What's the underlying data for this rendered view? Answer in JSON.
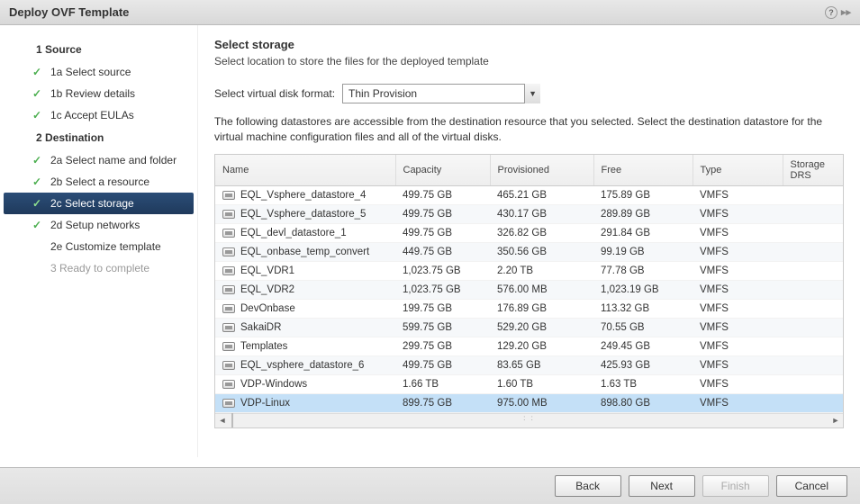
{
  "title": "Deploy OVF Template",
  "sidebar": {
    "sections": [
      {
        "num": "1",
        "label": "Source"
      },
      {
        "num": "2",
        "label": "Destination"
      }
    ],
    "items": [
      {
        "label": "1a Select source",
        "done": true
      },
      {
        "label": "1b Review details",
        "done": true
      },
      {
        "label": "1c Accept EULAs",
        "done": true
      },
      {
        "label": "2a Select name and folder",
        "done": true
      },
      {
        "label": "2b Select a resource",
        "done": true
      },
      {
        "label": "2c Select storage",
        "done": true,
        "current": true
      },
      {
        "label": "2d Setup networks",
        "done": true
      },
      {
        "label": "2e Customize template",
        "done": false
      },
      {
        "label": "3 Ready to complete",
        "done": false,
        "pending": true
      }
    ]
  },
  "main": {
    "heading": "Select storage",
    "subtitle": "Select location to store the files for the deployed template",
    "disk_format_label": "Select virtual disk format:",
    "disk_format_value": "Thin Provision",
    "description": "The following datastores are accessible from the destination resource that you selected. Select the destination datastore for the virtual machine configuration files and all of the virtual disks.",
    "columns": {
      "name": "Name",
      "capacity": "Capacity",
      "provisioned": "Provisioned",
      "free": "Free",
      "type": "Type",
      "storage_drs": "Storage DRS"
    },
    "rows": [
      {
        "name": "EQL_Vsphere_datastore_4",
        "capacity": "499.75 GB",
        "provisioned": "465.21 GB",
        "free": "175.89 GB",
        "type": "VMFS"
      },
      {
        "name": "EQL_Vsphere_datastore_5",
        "capacity": "499.75 GB",
        "provisioned": "430.17 GB",
        "free": "289.89 GB",
        "type": "VMFS"
      },
      {
        "name": "EQL_devl_datastore_1",
        "capacity": "499.75 GB",
        "provisioned": "326.82 GB",
        "free": "291.84 GB",
        "type": "VMFS"
      },
      {
        "name": "EQL_onbase_temp_convert",
        "capacity": "449.75 GB",
        "provisioned": "350.56 GB",
        "free": "99.19 GB",
        "type": "VMFS"
      },
      {
        "name": "EQL_VDR1",
        "capacity": "1,023.75 GB",
        "provisioned": "2.20 TB",
        "free": "77.78 GB",
        "type": "VMFS"
      },
      {
        "name": "EQL_VDR2",
        "capacity": "1,023.75 GB",
        "provisioned": "576.00 MB",
        "free": "1,023.19 GB",
        "type": "VMFS"
      },
      {
        "name": "DevOnbase",
        "capacity": "199.75 GB",
        "provisioned": "176.89 GB",
        "free": "113.32 GB",
        "type": "VMFS"
      },
      {
        "name": "SakaiDR",
        "capacity": "599.75 GB",
        "provisioned": "529.20 GB",
        "free": "70.55 GB",
        "type": "VMFS"
      },
      {
        "name": "Templates",
        "capacity": "299.75 GB",
        "provisioned": "129.20 GB",
        "free": "249.45 GB",
        "type": "VMFS"
      },
      {
        "name": "EQL_vsphere_datastore_6",
        "capacity": "499.75 GB",
        "provisioned": "83.65 GB",
        "free": "425.93 GB",
        "type": "VMFS"
      },
      {
        "name": "VDP-Windows",
        "capacity": "1.66 TB",
        "provisioned": "1.60 TB",
        "free": "1.63 TB",
        "type": "VMFS"
      },
      {
        "name": "VDP-Linux",
        "capacity": "899.75 GB",
        "provisioned": "975.00 MB",
        "free": "898.80 GB",
        "type": "VMFS",
        "selected": true
      }
    ]
  },
  "footer": {
    "back": "Back",
    "next": "Next",
    "finish": "Finish",
    "cancel": "Cancel"
  }
}
